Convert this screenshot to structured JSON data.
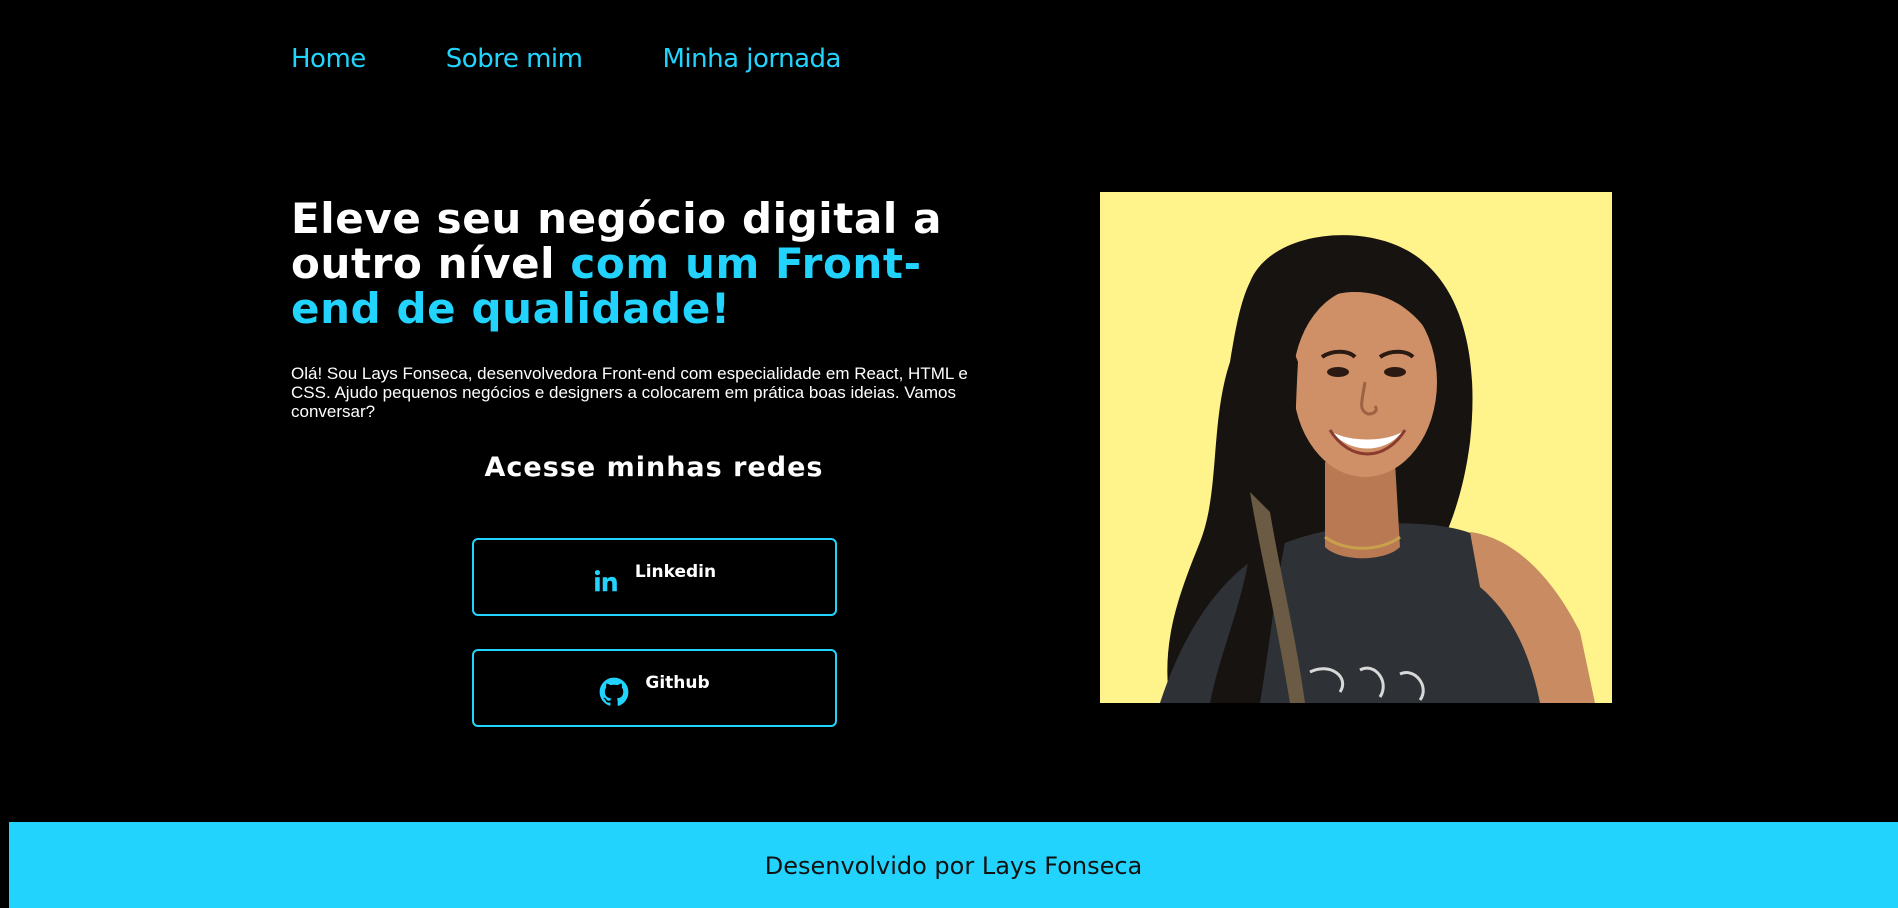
{
  "nav": {
    "items": [
      {
        "label": "Home"
      },
      {
        "label": "Sobre mim"
      },
      {
        "label": "Minha jornada"
      }
    ]
  },
  "hero": {
    "headline_white": "Eleve seu negócio digital a outro nível ",
    "headline_highlight": "com um Front-end de qualidade!",
    "intro": "Olá! Sou Lays Fonseca, desenvolvedora Front-end com especialidade em React, HTML e CSS. Ajudo pequenos negócios e designers a colocarem em prática boas ideias. Vamos conversar?"
  },
  "social": {
    "title": "Acesse minhas redes",
    "buttons": [
      {
        "label": "Linkedin",
        "icon": "linkedin-icon"
      },
      {
        "label": "Github",
        "icon": "github-icon"
      }
    ]
  },
  "portrait": {
    "background": "#fff38b"
  },
  "footer": {
    "text": "Desenvolvido por Lays Fonseca"
  },
  "colors": {
    "accent": "#22d4fd",
    "background": "#000000",
    "text": "#ffffff"
  }
}
